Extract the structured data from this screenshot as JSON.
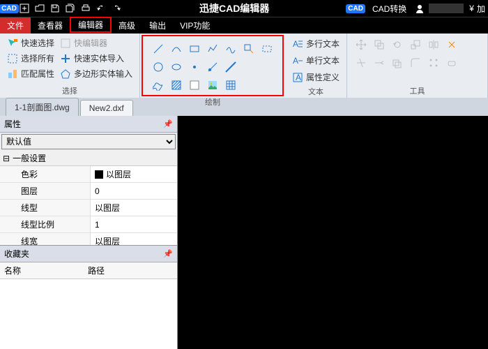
{
  "titlebar": {
    "app_title": "迅捷CAD编辑器",
    "cad_convert": "CAD转换",
    "currency": "加"
  },
  "menu": {
    "file": "文件",
    "viewer": "查看器",
    "editor": "编辑器",
    "advanced": "高级",
    "output": "输出",
    "vip": "VIP功能"
  },
  "ribbon": {
    "select": {
      "quick_select": "快速选择",
      "quick_editor": "快编辑器",
      "select_all": "选择所有",
      "quick_entity_import": "快速实体导入",
      "match_props": "匹配属性",
      "polygon_entity_input": "多边形实体输入",
      "label": "选择"
    },
    "draw": {
      "label": "绘制"
    },
    "text": {
      "multiline": "多行文本",
      "singleline": "单行文本",
      "attrdef": "属性定义",
      "label": "文本"
    },
    "tools": {
      "label": "工具"
    }
  },
  "tabs": {
    "t1": "1-1剖面图.dwg",
    "t2": "New2.dxf"
  },
  "panel": {
    "props_title": "属性",
    "default": "默认值",
    "general": "一般设置",
    "rows": {
      "color_k": "色彩",
      "color_v": "以图层",
      "layer_k": "图层",
      "layer_v": "0",
      "linetype_k": "线型",
      "linetype_v": "以图层",
      "ltscale_k": "线型比例",
      "ltscale_v": "1",
      "lw_k": "线宽",
      "lw_v": "以图层"
    },
    "fav_title": "收藏夹",
    "fav_name": "名称",
    "fav_path": "路径"
  }
}
